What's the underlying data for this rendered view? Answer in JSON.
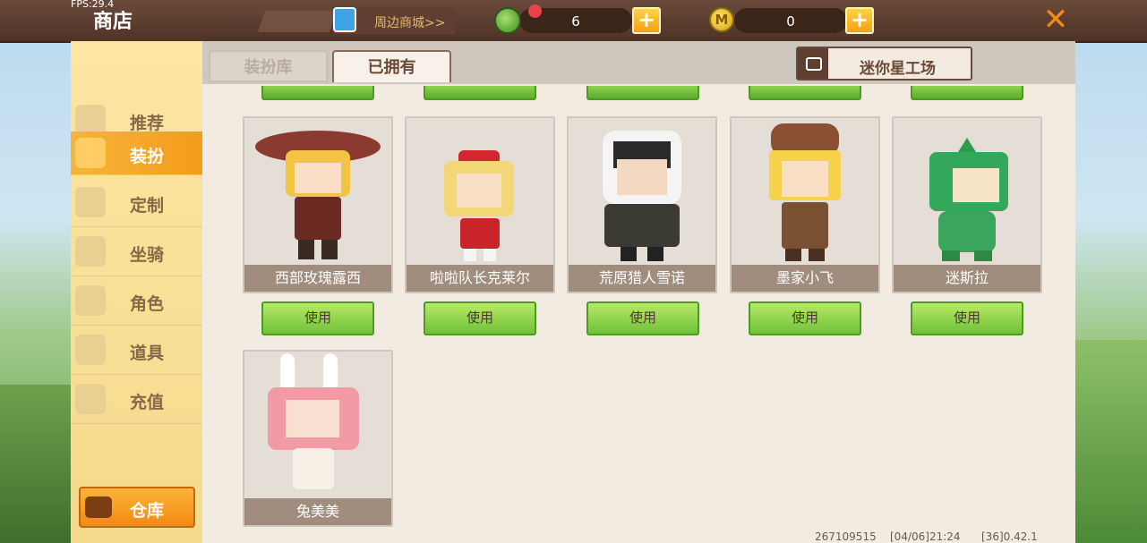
{
  "top_bar": {
    "fps": "FPS:29.4",
    "title": "商店",
    "merch_label": "周边商城>>",
    "currency_beans": "6",
    "currency_coins": "0",
    "coin_symbol": "M",
    "plus": "+",
    "close": "✕"
  },
  "sidebar": {
    "items": [
      {
        "label": "推荐",
        "icon": "thumbs-up-icon"
      },
      {
        "label": "装扮",
        "icon": "outfit-icon"
      },
      {
        "label": "定制",
        "icon": "customize-icon"
      },
      {
        "label": "坐骑",
        "icon": "mount-icon"
      },
      {
        "label": "角色",
        "icon": "character-icon"
      },
      {
        "label": "道具",
        "icon": "props-icon"
      },
      {
        "label": "充值",
        "icon": "coins-icon"
      }
    ],
    "active": "装扮",
    "warehouse_label": "仓库"
  },
  "tabs": {
    "inactive": "装扮库",
    "active": "已拥有"
  },
  "workshop_label": "迷你星工场",
  "skins": [
    {
      "name": "西部玫瑰露西",
      "button": "使用",
      "hair": "#f3c443",
      "outfit": "#6a2a22",
      "hat": "#8a3a2e"
    },
    {
      "name": "啦啦队长克莱尔",
      "button": "使用",
      "hair": "#f2d777",
      "outfit": "#c9242a",
      "hat": "#d3262e"
    },
    {
      "name": "荒原猎人雪诺",
      "button": "使用",
      "hair": "#2a2a2a",
      "outfit": "#3a3a32",
      "hat": "#f4f4f4"
    },
    {
      "name": "墨家小飞",
      "button": "使用",
      "hair": "#f6d24a",
      "outfit": "#7a5032",
      "hat": "#8a5034"
    },
    {
      "name": "迷斯拉",
      "button": "使用",
      "hair": "#34a85a",
      "outfit": "#3aa55c",
      "hat": "#2d9a4e"
    },
    {
      "name": "兔美美",
      "button": "",
      "hair": "#f29aa6",
      "outfit": "#f6f0e6",
      "hat": "#ffffff"
    }
  ],
  "footer": {
    "uid": "267109515",
    "datetime": "[04/06]21:24",
    "version": "[36]0.42.1"
  }
}
